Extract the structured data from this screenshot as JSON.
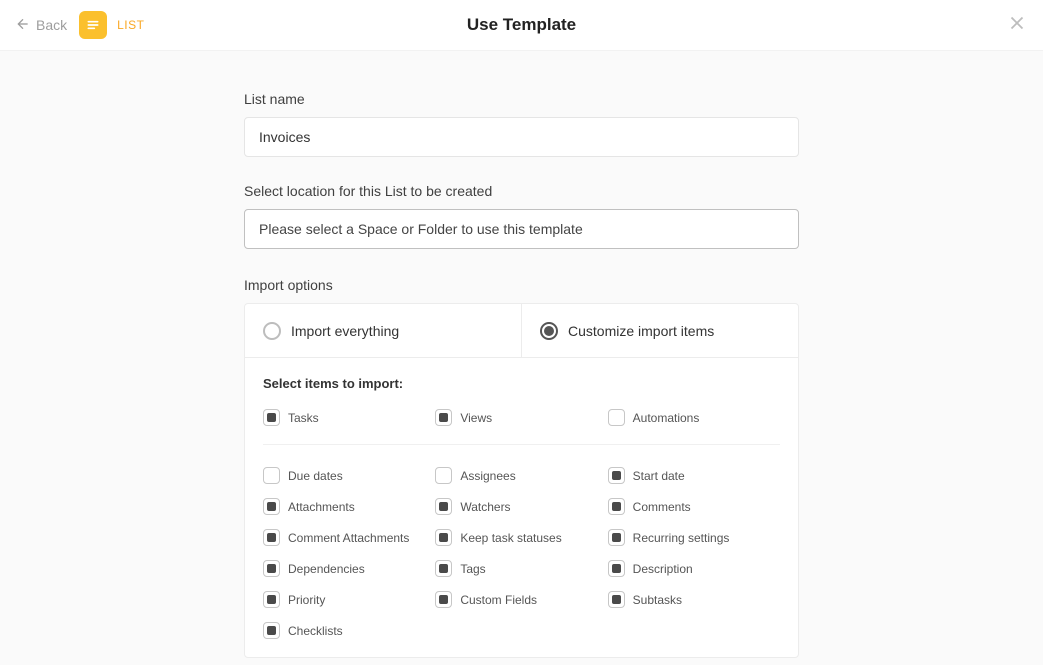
{
  "header": {
    "back_label": "Back",
    "type_label": "LIST",
    "title": "Use Template"
  },
  "form": {
    "list_name_label": "List name",
    "list_name_value": "Invoices",
    "location_label": "Select location for this List to be created",
    "location_placeholder": "Please select a Space or Folder to use this template",
    "import_options_label": "Import options",
    "tab_everything": "Import everything",
    "tab_customize": "Customize import items",
    "select_items_label": "Select items to import:"
  },
  "items_top": [
    {
      "label": "Tasks",
      "checked": true
    },
    {
      "label": "Views",
      "checked": true
    },
    {
      "label": "Automations",
      "checked": false
    }
  ],
  "items_rest": [
    {
      "label": "Due dates",
      "checked": false
    },
    {
      "label": "Assignees",
      "checked": false
    },
    {
      "label": "Start date",
      "checked": true
    },
    {
      "label": "Attachments",
      "checked": true
    },
    {
      "label": "Watchers",
      "checked": true
    },
    {
      "label": "Comments",
      "checked": true
    },
    {
      "label": "Comment Attachments",
      "checked": true
    },
    {
      "label": "Keep task statuses",
      "checked": true
    },
    {
      "label": "Recurring settings",
      "checked": true
    },
    {
      "label": "Dependencies",
      "checked": true
    },
    {
      "label": "Tags",
      "checked": true
    },
    {
      "label": "Description",
      "checked": true
    },
    {
      "label": "Priority",
      "checked": true
    },
    {
      "label": "Custom Fields",
      "checked": true
    },
    {
      "label": "Subtasks",
      "checked": true
    },
    {
      "label": "Checklists",
      "checked": true
    }
  ]
}
